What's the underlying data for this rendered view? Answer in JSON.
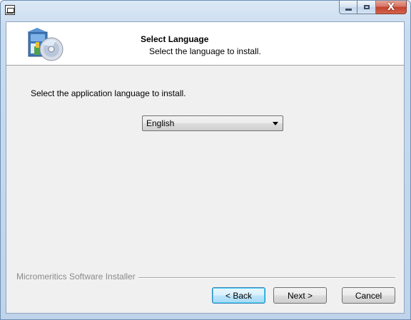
{
  "window": {
    "caption": {
      "minimize_icon": "minimize-icon",
      "maximize_icon": "maximize-icon",
      "close_glyph": "X"
    }
  },
  "header": {
    "title": "Select Language",
    "subtitle": "Select the language to install.",
    "icon": "installer-cd-icon"
  },
  "main": {
    "instruction": "Select the application language to install.",
    "language_select": {
      "value": "English"
    }
  },
  "footer": {
    "brand_label": "Micromeritics Software Installer",
    "buttons": {
      "back": "< Back",
      "next": "Next >",
      "cancel": "Cancel"
    }
  },
  "colors": {
    "frame": "#c9dbef",
    "client": "#f0f0f0",
    "close_button": "#c1422d",
    "focus_border": "#3c7fb1"
  }
}
